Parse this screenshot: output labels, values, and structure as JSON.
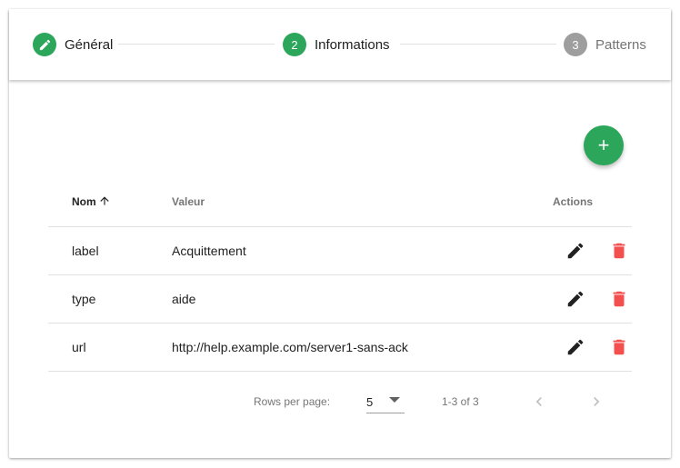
{
  "colors": {
    "accent": "#2ca65a",
    "inactive_step": "#9e9e9e",
    "delete": "#f44f4f",
    "edit": "#212121"
  },
  "stepper": {
    "steps": [
      {
        "number": "",
        "icon": "pencil-icon",
        "label": "Général",
        "state": "done"
      },
      {
        "number": "2",
        "label": "Informations",
        "state": "active"
      },
      {
        "number": "3",
        "label": "Patterns",
        "state": "inactive"
      }
    ]
  },
  "fab": {
    "icon": "plus-icon",
    "label": "+"
  },
  "table": {
    "columns": [
      "Nom",
      "Valeur",
      "Actions"
    ],
    "sort": {
      "column": "Nom",
      "direction": "asc",
      "icon": "arrow-up-icon"
    },
    "rows": [
      {
        "nom": "label",
        "valeur": "Acquittement"
      },
      {
        "nom": "type",
        "valeur": "aide"
      },
      {
        "nom": "url",
        "valeur": "http://help.example.com/server1-sans-ack"
      }
    ],
    "row_actions": [
      {
        "icon": "pencil-icon",
        "name": "edit"
      },
      {
        "icon": "trash-icon",
        "name": "delete"
      }
    ]
  },
  "pagination": {
    "rows_per_page_label": "Rows per page:",
    "rows_per_page_value": "5",
    "range_text": "1-3 of 3",
    "prev_icon": "chevron-left-icon",
    "next_icon": "chevron-right-icon"
  }
}
